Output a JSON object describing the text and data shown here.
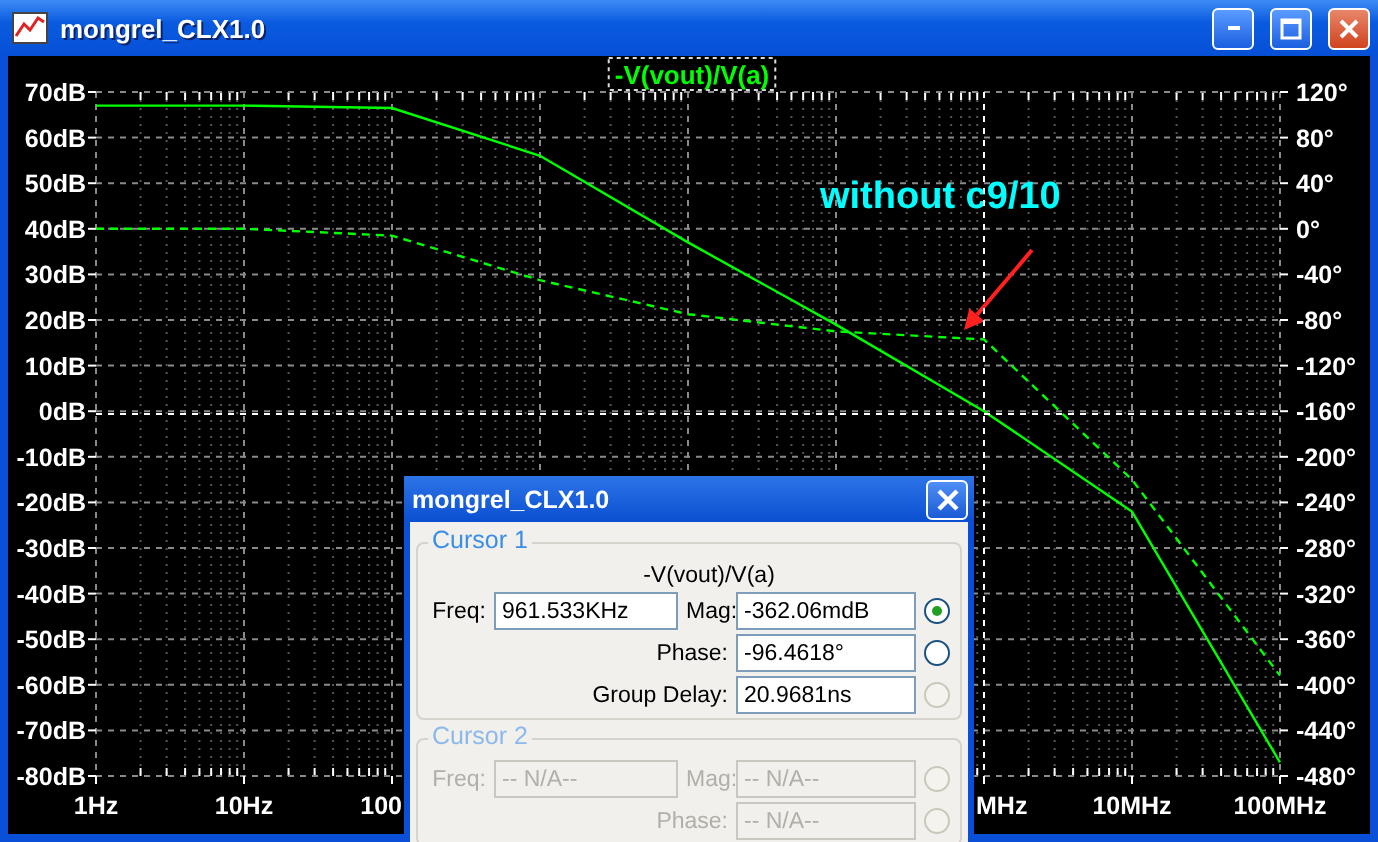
{
  "window": {
    "title": "mongrel_CLX1.0"
  },
  "plot": {
    "chart_data": {
      "type": "line",
      "title": "-V(vout)/V(a)",
      "categories": [
        "1Hz",
        "10Hz",
        "100",
        null,
        null,
        null,
        "MHz",
        "10MHz",
        "100MHz"
      ],
      "series": [
        {
          "color": "#00ff00",
          "line_style": "solid",
          "values": [
            67,
            67,
            66.5,
            56,
            37,
            19,
            0,
            -22,
            -77
          ]
        },
        {
          "color": "#00ff00",
          "axis": "y2",
          "line_style": "dashed",
          "values": [
            0,
            0,
            -6,
            -45,
            -75,
            -90,
            -97,
            -220,
            -392
          ]
        }
      ],
      "grid": true,
      "ylim": [
        -80,
        70
      ],
      "y2lim": [
        -480,
        120
      ],
      "yticks": [
        {
          "value": 70,
          "label": "70dB"
        },
        {
          "value": 60,
          "label": "60dB"
        },
        {
          "value": 50,
          "label": "50dB"
        },
        {
          "value": 40,
          "label": "40dB"
        },
        {
          "value": 30,
          "label": "30dB"
        },
        {
          "value": 20,
          "label": "20dB"
        },
        {
          "value": 10,
          "label": "10dB"
        },
        {
          "value": 0,
          "label": "0dB"
        },
        {
          "value": -10,
          "label": "-10dB"
        },
        {
          "value": -20,
          "label": "-20dB"
        },
        {
          "value": -30,
          "label": "-30dB"
        },
        {
          "value": -40,
          "label": "-40dB"
        },
        {
          "value": -50,
          "label": "-50dB"
        },
        {
          "value": -60,
          "label": "-60dB"
        },
        {
          "value": -70,
          "label": "-70dB"
        },
        {
          "value": -80,
          "label": "-80dB"
        }
      ],
      "y2ticks": [
        {
          "value": 120,
          "label": "120°"
        },
        {
          "value": 80,
          "label": "80°"
        },
        {
          "value": 40,
          "label": "40°"
        },
        {
          "value": 0,
          "label": "0°"
        },
        {
          "value": -40,
          "label": "-40°"
        },
        {
          "value": -80,
          "label": "-80°"
        },
        {
          "value": -120,
          "label": "-120°"
        },
        {
          "value": -160,
          "label": "-160°"
        },
        {
          "value": -200,
          "label": "-200°"
        },
        {
          "value": -240,
          "label": "-240°"
        },
        {
          "value": -280,
          "label": "-280°"
        },
        {
          "value": -320,
          "label": "-320°"
        },
        {
          "value": -360,
          "label": "-360°"
        },
        {
          "value": -400,
          "label": "-400°"
        },
        {
          "value": -440,
          "label": "-440°"
        },
        {
          "value": -480,
          "label": "-480°"
        }
      ],
      "annotations": [
        "without c9/10"
      ]
    }
  },
  "dialog": {
    "title": "mongrel_CLX1.0",
    "groups": [
      {
        "label": "Cursor 1",
        "disabled": false,
        "trace": "-V(vout)/V(a)",
        "freq": {
          "label": "Freq:",
          "value": "961.533KHz"
        },
        "rows": [
          {
            "label": "Mag:",
            "value": "-362.06mdB",
            "selected": true,
            "disabled": false
          },
          {
            "label": "Phase:",
            "value": "-96.4618°",
            "selected": false,
            "disabled": false
          },
          {
            "label": "Group Delay:",
            "value": "20.9681ns",
            "selected": false,
            "disabled": true
          }
        ]
      },
      {
        "label": "Cursor 2",
        "disabled": true,
        "freq": {
          "label": "Freq:",
          "value": "-- N/A--"
        },
        "rows": [
          {
            "label": "Mag:",
            "value": "-- N/A--",
            "selected": false,
            "disabled": true
          },
          {
            "label": "Phase:",
            "value": "-- N/A--",
            "selected": false,
            "disabled": true
          }
        ]
      }
    ]
  }
}
